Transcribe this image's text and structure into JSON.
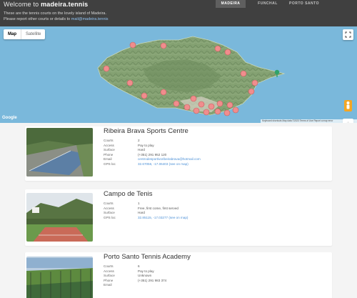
{
  "header": {
    "brand_prefix": "Welcome to ",
    "brand_name": "madeira.tennis",
    "intro_line1": "These are the tennis courts on the lovely island of Madeira.",
    "intro_line2_prefix": "Please report other courts or details to ",
    "contact_email": "mail@madeira.tennis",
    "nav": [
      {
        "label": "MADEIRA",
        "active": true
      },
      {
        "label": "FUNCHAL",
        "active": false
      },
      {
        "label": "PORTO SANTO",
        "active": false
      }
    ]
  },
  "map": {
    "type_options": [
      "Map",
      "Satellite"
    ],
    "selected_type": "Map",
    "google_logo": "Google",
    "attribution": "Keyboard shortcuts   Map data ©2023   Terms of Use   Report a map error",
    "zoom_in": "+",
    "zoom_out": "−",
    "colors": {
      "sea": "#7ab8db",
      "marker": "#f08d8d",
      "terrain": "#7f9a6e"
    }
  },
  "courts": [
    {
      "name": "Ribeira Brava Sports Centre",
      "fields": [
        {
          "key": "Courts",
          "value": "2",
          "link": false
        },
        {
          "key": "Access",
          "value": "Pay to play",
          "link": false
        },
        {
          "key": "Surface",
          "value": "Hard",
          "link": false
        },
        {
          "key": "Phone",
          "value": "(+351) 291 952 120",
          "link": false
        },
        {
          "key": "Email",
          "value": "centrodesportivoribeirabrava@hotmail.com",
          "link": true
        },
        {
          "key": "GPS loc",
          "value": "32.67056, -17.06403 (see on map)",
          "link": true
        }
      ]
    },
    {
      "name": "Campo de Tenis",
      "fields": [
        {
          "key": "Courts",
          "value": "1",
          "link": false
        },
        {
          "key": "Access",
          "value": "Free, first come, first served",
          "link": false
        },
        {
          "key": "Surface",
          "value": "Hard",
          "link": false
        },
        {
          "key": "GPS loc",
          "value": "32.85115, -17.03277 (see on map)",
          "link": true
        }
      ]
    },
    {
      "name": "Porto Santo Tennis Academy",
      "fields": [
        {
          "key": "Courts",
          "value": "6",
          "link": false
        },
        {
          "key": "Access",
          "value": "Pay to play",
          "link": false
        },
        {
          "key": "Surface",
          "value": "Unknown",
          "link": false
        },
        {
          "key": "Phone",
          "value": "(+351) 291 983 374",
          "link": false
        },
        {
          "key": "Email",
          "value": "",
          "link": false
        }
      ]
    }
  ]
}
